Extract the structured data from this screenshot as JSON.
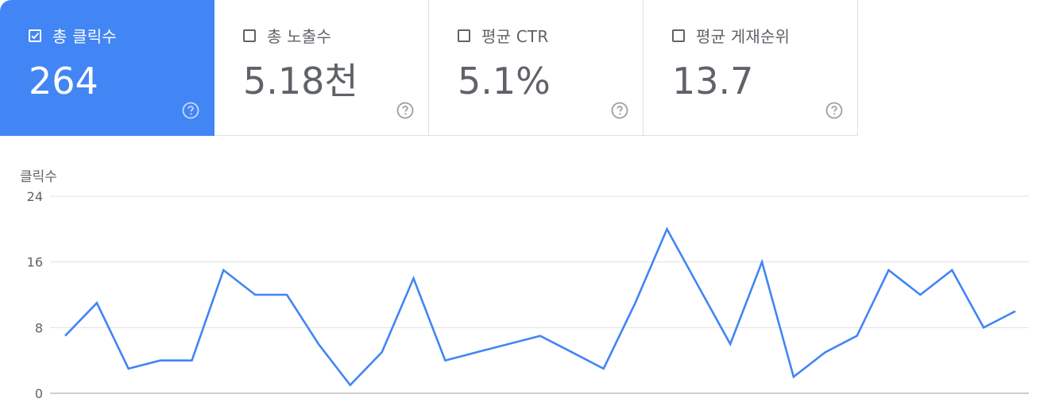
{
  "cards": [
    {
      "label": "총 클릭수",
      "value": "264",
      "checked": true
    },
    {
      "label": "총 노출수",
      "value": "5.18천",
      "checked": false
    },
    {
      "label": "평균 CTR",
      "value": "5.1%",
      "checked": false
    },
    {
      "label": "평균 게재순위",
      "value": "13.7",
      "checked": false
    }
  ],
  "colors": {
    "active_card": "#4285f4",
    "line": "#4285f4",
    "grid": "#e0e0e0",
    "text": "#5f6368"
  },
  "chart_data": {
    "type": "line",
    "ylabel": "클릭수",
    "ylim": [
      0,
      24
    ],
    "yticks": [
      "24",
      "16",
      "8",
      "0"
    ],
    "ytick_values": [
      24,
      16,
      8,
      0
    ],
    "series": [
      {
        "values": [
          7,
          11,
          3,
          4,
          4,
          15,
          12,
          12,
          6,
          1,
          5,
          14,
          4,
          5,
          6,
          7,
          5,
          3,
          11,
          20,
          13,
          6,
          16,
          2,
          5,
          7,
          15,
          12,
          15,
          8,
          10
        ]
      }
    ]
  }
}
